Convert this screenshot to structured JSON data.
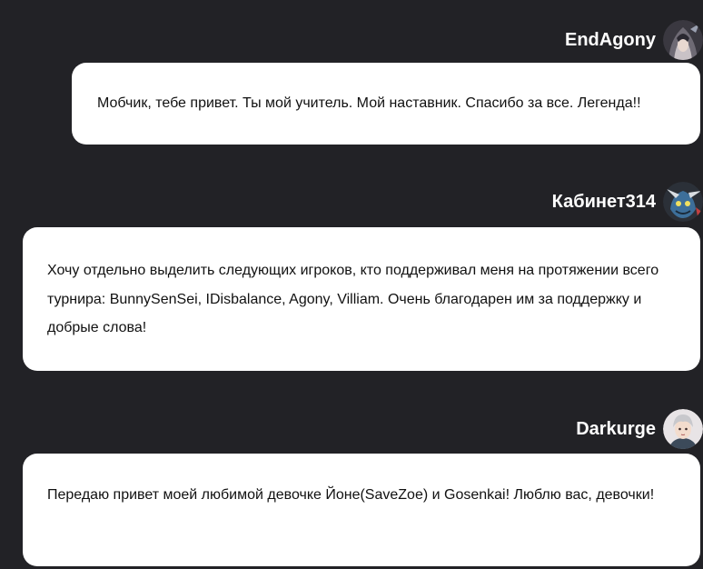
{
  "messages": [
    {
      "username": "EndAgony",
      "avatar": "avatar-hooded-warrior",
      "text": "Мобчик, тебе привет. Ты мой учитель. Мой наставник. Спасибо за все. Легенда!!"
    },
    {
      "username": "Кабинет314",
      "avatar": "avatar-blue-creature",
      "text": "Хочу отдельно выделить следующих игроков, кто поддерживал меня на протяжении всего турнира: BunnySenSei, IDisbalance, Agony, Villiam. Очень благодарен им за поддержку и добрые слова!"
    },
    {
      "username": "Darkurge",
      "avatar": "avatar-silver-hair-hero",
      "text": "Передаю привет моей любимой девочке Йоне(SaveZoe) и Gosenkai! Люблю вас, девочки!"
    }
  ],
  "colors": {
    "background": "#222226",
    "bubble": "#ffffff",
    "username": "#ffffff",
    "text": "#111111"
  }
}
